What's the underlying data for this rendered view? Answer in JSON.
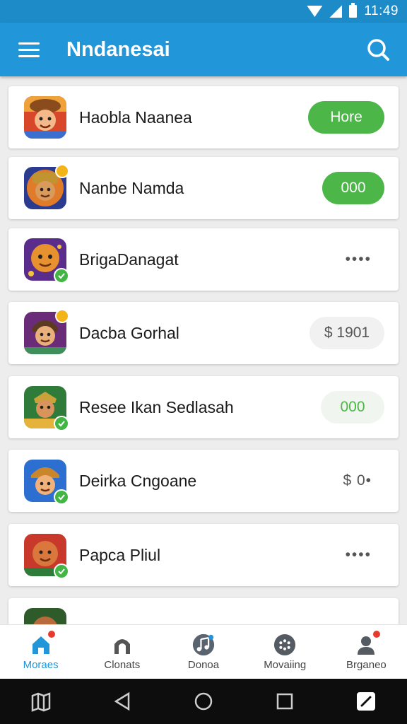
{
  "status_bar": {
    "time": "11:49"
  },
  "app_bar": {
    "title": "Nndanesai"
  },
  "items": [
    {
      "title": "Haobla Naanea",
      "action": "Hore",
      "action_style": "green"
    },
    {
      "title": "Nanbe Namda",
      "action": "000",
      "action_style": "green"
    },
    {
      "title": "BrigaDanagat",
      "action": "••••",
      "action_style": "text"
    },
    {
      "title": "Dacba Gorhal",
      "action": "$ 1901",
      "action_style": "grey"
    },
    {
      "title": "Resee Ikan Sedlasah",
      "action": "000",
      "action_style": "light-green"
    },
    {
      "title": "Deirka Cngoane",
      "action": "$ 0•",
      "action_style": "text"
    },
    {
      "title": "Papca Pliul",
      "action": "••••",
      "action_style": "text"
    }
  ],
  "bottom_nav": [
    {
      "label": "Moraes",
      "icon": "home-icon",
      "active": true
    },
    {
      "label": "Clonats",
      "icon": "arch-icon",
      "active": false
    },
    {
      "label": "Donoa",
      "icon": "music-icon",
      "active": false
    },
    {
      "label": "Movaiing",
      "icon": "dots-circle-icon",
      "active": false
    },
    {
      "label": "Brganeo",
      "icon": "person-icon",
      "active": false
    }
  ],
  "colors": {
    "app_bar": "#2196d8",
    "status_bar": "#1e8bc9",
    "green": "#4cb648",
    "badge_red": "#e53b2c"
  }
}
